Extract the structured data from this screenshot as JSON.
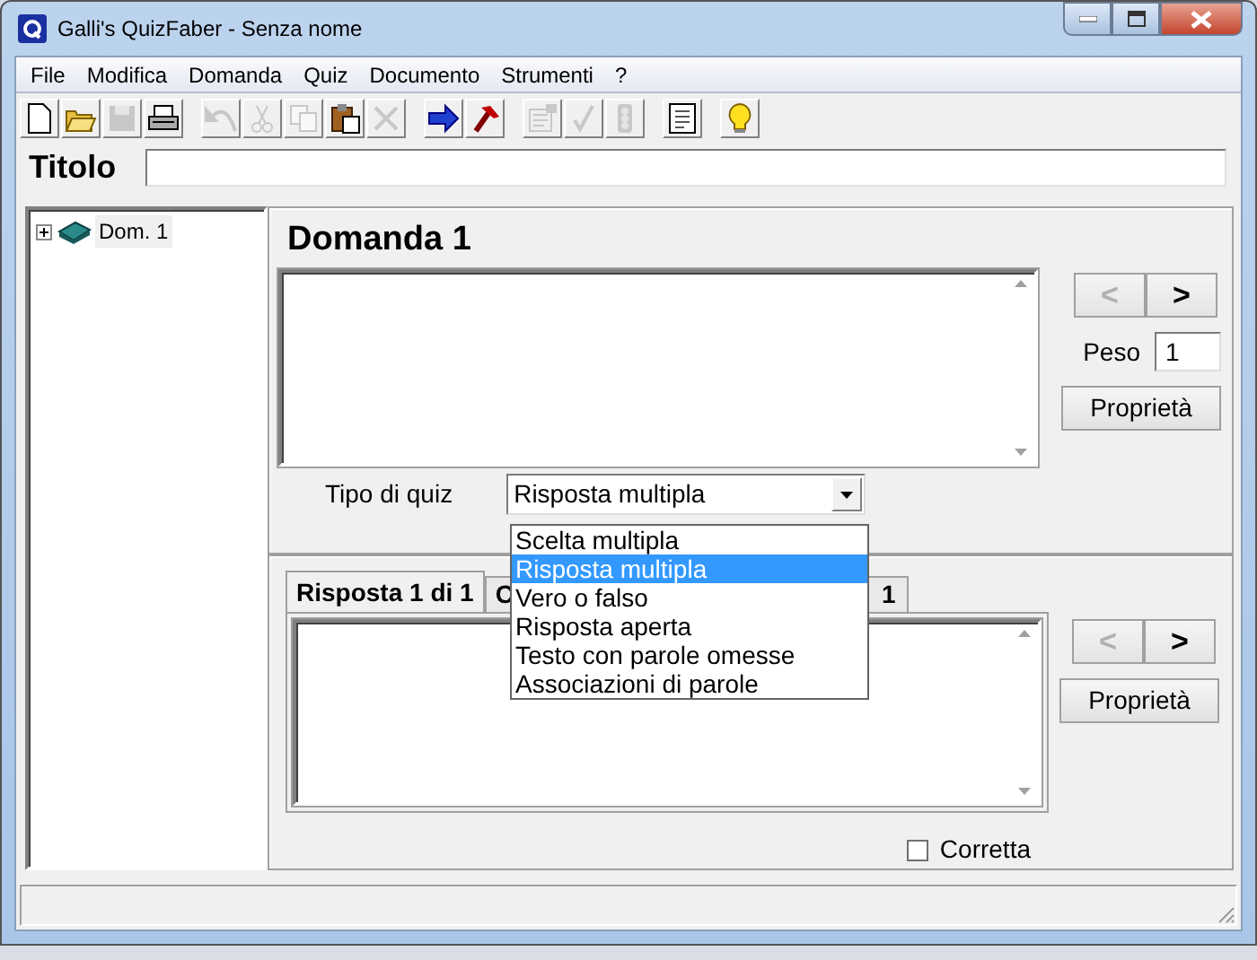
{
  "window": {
    "title": "Galli's QuizFaber - Senza nome"
  },
  "menu": [
    "File",
    "Modifica",
    "Domanda",
    "Quiz",
    "Documento",
    "Strumenti",
    "?"
  ],
  "toolbar": [
    [
      {
        "kind": "new",
        "disabled": false
      },
      {
        "kind": "open",
        "disabled": false
      },
      {
        "kind": "save",
        "disabled": true
      },
      {
        "kind": "print",
        "disabled": false
      }
    ],
    [
      {
        "kind": "undo",
        "disabled": true
      },
      {
        "kind": "cut",
        "disabled": true
      },
      {
        "kind": "copy",
        "disabled": true
      },
      {
        "kind": "paste",
        "disabled": false
      },
      {
        "kind": "delete",
        "disabled": true
      }
    ],
    [
      {
        "kind": "arrow",
        "disabled": false
      },
      {
        "kind": "hammer",
        "disabled": false
      }
    ],
    [
      {
        "kind": "properties",
        "disabled": true
      },
      {
        "kind": "check",
        "disabled": true
      },
      {
        "kind": "lights",
        "disabled": true
      }
    ],
    [
      {
        "kind": "form",
        "disabled": false
      }
    ],
    [
      {
        "kind": "help",
        "disabled": false
      }
    ]
  ],
  "title_field": {
    "label": "Titolo"
  },
  "tree": [
    {
      "label": "Dom. 1",
      "expanded": false
    }
  ],
  "question": {
    "heading": "Domanda 1",
    "nav": [
      {
        "label": "<",
        "disabled": true
      },
      {
        "label": ">",
        "disabled": false
      }
    ],
    "weight_label": "Peso",
    "weight_value": "1",
    "properties_button": "Proprietà",
    "quiz_type_label": "Tipo di quiz",
    "quiz_type_value": "Risposta multipla"
  },
  "dropdown": {
    "expanded": true,
    "options": [
      {
        "label": "Scelta multipla",
        "selected": false
      },
      {
        "label": "Risposta multipla",
        "selected": true
      },
      {
        "label": "Vero o falso",
        "selected": false
      },
      {
        "label": "Risposta aperta",
        "selected": false
      },
      {
        "label": "Testo con parole omesse",
        "selected": false
      },
      {
        "label": "Associazioni di parole",
        "selected": false
      }
    ]
  },
  "answer": {
    "tabs": [
      {
        "label": "Risposta 1 di 1",
        "selected": true
      },
      {
        "label_start": "C",
        "label_end": "1",
        "selected": false
      }
    ],
    "nav": [
      {
        "label": "<",
        "disabled": true
      },
      {
        "label": ">",
        "disabled": false
      }
    ],
    "properties_button": "Proprietà",
    "correct": {
      "label": "Corretta",
      "checked": false
    }
  }
}
